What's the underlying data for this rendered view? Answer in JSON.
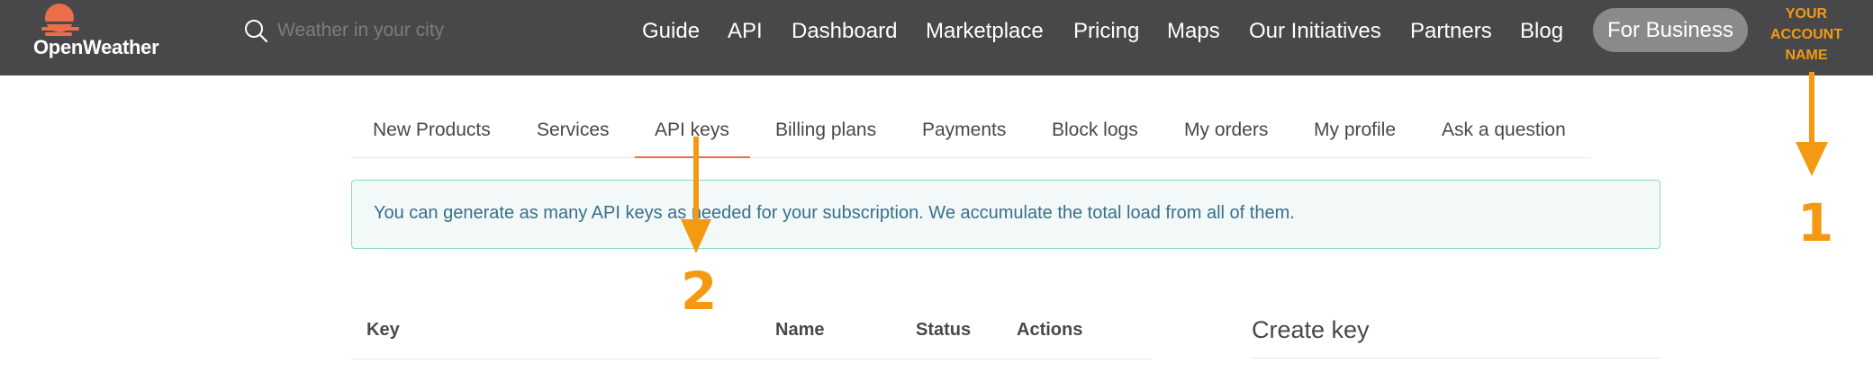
{
  "header": {
    "logo_text": "OpenWeather",
    "search_placeholder": "Weather in your city",
    "nav": [
      "Guide",
      "API",
      "Dashboard",
      "Marketplace",
      "Pricing",
      "Maps",
      "Our Initiatives",
      "Partners",
      "Blog"
    ],
    "business_button": "For Business",
    "account_label": [
      "YOUR",
      "ACCOUNT",
      "NAME"
    ]
  },
  "tabs": {
    "items": [
      "New Products",
      "Services",
      "API keys",
      "Billing plans",
      "Payments",
      "Block logs",
      "My orders",
      "My profile",
      "Ask a question"
    ],
    "active": "API keys"
  },
  "alert": {
    "text": "You can generate as many API keys as needed for your subscription. We accumulate the total load from all of them."
  },
  "keys_table": {
    "columns": [
      "Key",
      "Name",
      "Status",
      "Actions"
    ]
  },
  "create_key": {
    "title": "Create key"
  },
  "annotations": {
    "marker_1": "1",
    "marker_2": "2"
  },
  "colors": {
    "header_bg": "#48484a",
    "brand_orange": "#eb6e4b",
    "annotation_orange": "#f39a12",
    "active_tab_underline": "#e96e50",
    "alert_border": "#8fd9c6",
    "alert_text": "#3a6f8a"
  },
  "icons": [
    "openweather-logo-icon",
    "search-icon",
    "arrow-down-icon"
  ]
}
